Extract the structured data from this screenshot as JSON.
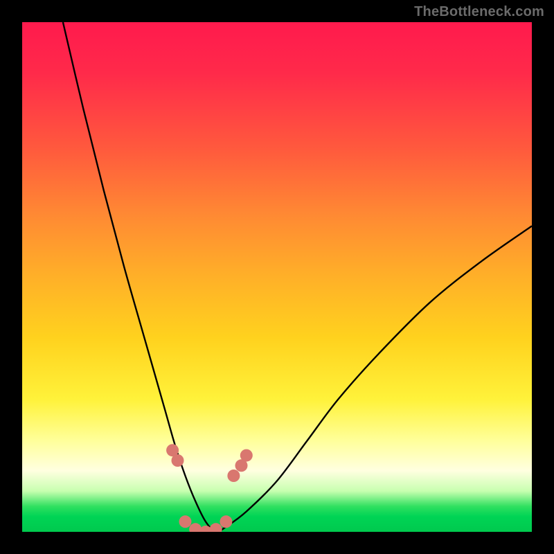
{
  "watermark": "TheBottleneck.com",
  "chart_data": {
    "type": "line",
    "title": "",
    "xlabel": "",
    "ylabel": "",
    "xlim": [
      0,
      100
    ],
    "ylim": [
      0,
      100
    ],
    "grid": false,
    "series": [
      {
        "name": "bottleneck-curve",
        "x": [
          8,
          12,
          16,
          20,
          24,
          28,
          30,
          32,
          34,
          36,
          38,
          40,
          44,
          50,
          56,
          62,
          70,
          80,
          90,
          100
        ],
        "y": [
          100,
          83,
          67,
          52,
          38,
          24,
          17,
          11,
          6,
          2,
          0,
          1,
          4,
          10,
          18,
          26,
          35,
          45,
          53,
          60
        ]
      }
    ],
    "markers": {
      "name": "highlight-dots",
      "color": "#d9776f",
      "points_x": [
        29.5,
        30.5,
        32,
        34,
        36,
        38,
        40,
        41.5,
        43,
        44
      ],
      "points_y": [
        16,
        14,
        2,
        0.5,
        0,
        0.5,
        2,
        11,
        13,
        15
      ]
    }
  }
}
